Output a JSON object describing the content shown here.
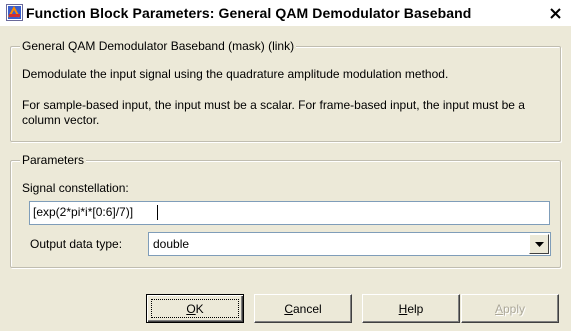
{
  "window": {
    "title": "Function Block Parameters: General QAM Demodulator Baseband",
    "close_glyph": "✕"
  },
  "mask_group": {
    "legend": "General QAM Demodulator Baseband (mask) (link)",
    "description_1": "Demodulate the input signal using the quadrature amplitude modulation method.",
    "description_2": "For sample-based input, the input must be a scalar. For frame-based input, the input must be a column vector."
  },
  "parameters": {
    "legend": "Parameters",
    "signal_constellation_label": "Signal constellation:",
    "signal_constellation_value": "[exp(2*pi*i*[0:6]/7)]",
    "output_data_type_label": "Output data type:",
    "output_data_type_value": "double"
  },
  "buttons": {
    "ok": {
      "mnemonic": "O",
      "rest": "K"
    },
    "cancel": {
      "mnemonic": "C",
      "rest": "ancel"
    },
    "help": {
      "mnemonic": "H",
      "rest": "elp"
    },
    "apply": {
      "mnemonic": "A",
      "rest": "pply",
      "enabled": false
    }
  },
  "icons": {
    "app": "simulink-block-icon",
    "close": "close-icon",
    "dropdown": "chevron-down-icon"
  }
}
